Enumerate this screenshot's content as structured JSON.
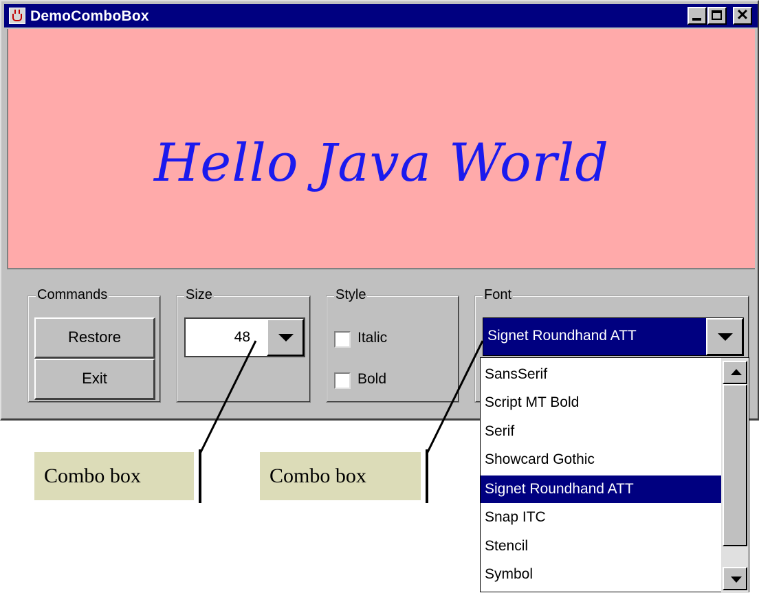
{
  "window": {
    "title": "DemoComboBox",
    "controls": [
      "minimize-icon",
      "maximize-icon",
      "close-icon"
    ],
    "close_glyph": "✕"
  },
  "canvas": {
    "text": "Hello Java World",
    "background": "#ffaaaa",
    "text_color": "#1a1aee"
  },
  "commands": {
    "label": "Commands",
    "restore": "Restore",
    "exit": "Exit"
  },
  "size": {
    "label": "Size",
    "value": "48"
  },
  "style": {
    "label": "Style",
    "italic": "Italic",
    "bold": "Bold",
    "italic_checked": false,
    "bold_checked": false
  },
  "font": {
    "label": "Font",
    "value": "Signet Roundhand ATT",
    "options": [
      "SansSerif",
      "Script MT Bold",
      "Serif",
      "Showcard Gothic",
      "Signet Roundhand ATT",
      "Snap ITC",
      "Stencil",
      "Symbol"
    ],
    "selected_index": 4
  },
  "callouts": [
    "Combo box",
    "Combo box"
  ],
  "colors": {
    "titlebar": "#000080",
    "selection": "#000080",
    "face": "#c0c0c0",
    "callout_bg": "#dcdcb8"
  }
}
